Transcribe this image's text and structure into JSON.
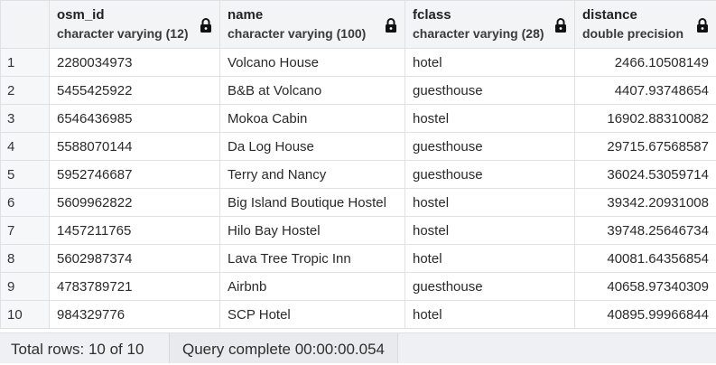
{
  "columns": [
    {
      "name": "osm_id",
      "type": "character varying (12)"
    },
    {
      "name": "name",
      "type": "character varying (100)"
    },
    {
      "name": "fclass",
      "type": "character varying (28)"
    },
    {
      "name": "distance",
      "type": "double precision"
    }
  ],
  "rows": [
    {
      "num": "1",
      "osm_id": "2280034973",
      "name": "Volcano House",
      "fclass": "hotel",
      "distance": "2466.10508149"
    },
    {
      "num": "2",
      "osm_id": "5455425922",
      "name": "B&B at Volcano",
      "fclass": "guesthouse",
      "distance": "4407.93748654"
    },
    {
      "num": "3",
      "osm_id": "6546436985",
      "name": "Mokoa Cabin",
      "fclass": "hostel",
      "distance": "16902.88310082"
    },
    {
      "num": "4",
      "osm_id": "5588070144",
      "name": "Da Log House",
      "fclass": "guesthouse",
      "distance": "29715.67568587"
    },
    {
      "num": "5",
      "osm_id": "5952746687",
      "name": "Terry and Nancy",
      "fclass": "guesthouse",
      "distance": "36024.53059714"
    },
    {
      "num": "6",
      "osm_id": "5609962822",
      "name": "Big Island Boutique Hostel",
      "fclass": "hostel",
      "distance": "39342.20931008"
    },
    {
      "num": "7",
      "osm_id": "1457211765",
      "name": "Hilo Bay Hostel",
      "fclass": "hostel",
      "distance": "39748.25646734"
    },
    {
      "num": "8",
      "osm_id": "5602987374",
      "name": "Lava Tree Tropic Inn",
      "fclass": "hotel",
      "distance": "40081.64356854"
    },
    {
      "num": "9",
      "osm_id": "4783789721",
      "name": "Airbnb",
      "fclass": "guesthouse",
      "distance": "40658.97340309"
    },
    {
      "num": "10",
      "osm_id": "984329776",
      "name": "SCP Hotel",
      "fclass": "hotel",
      "distance": "40895.99966844"
    }
  ],
  "status": {
    "total_rows": "Total rows: 10 of 10",
    "query": "Query complete 00:00:00.054"
  },
  "icons": {
    "lock": "lock-icon"
  }
}
